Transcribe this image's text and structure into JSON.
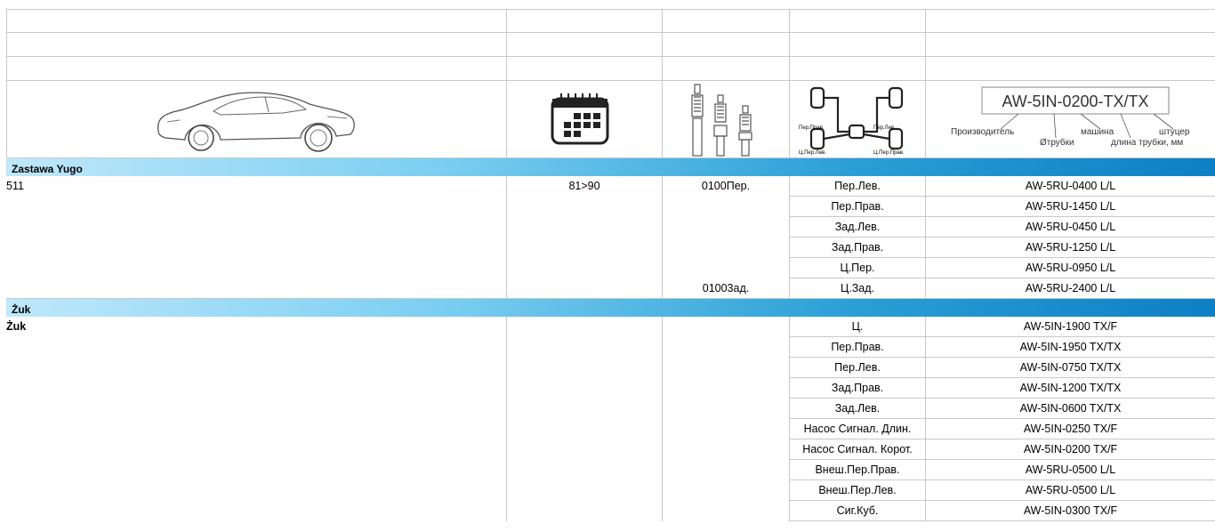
{
  "legend": {
    "code_sample": "AW-5IN-0200-TX/TX",
    "labels": {
      "manufacturer": "Производитель",
      "car": "машина",
      "fitting": "штуцер",
      "tube_diameter": "Øтрубки",
      "tube_length": "длина трубки, мм"
    },
    "axle_labels": {
      "front_right": "Пер.Прав.",
      "front_left": "Пер.Лев.",
      "center_rear_left": "Ц.Пер.Лев.",
      "center_rear_right": "Ц.Пер.Прав."
    }
  },
  "sections": [
    {
      "brand": "Zastawa Yugo",
      "model": "511",
      "years": "81>90",
      "codes": [
        "0100Пер.",
        "01003ад."
      ],
      "rows": [
        {
          "position": "Пер.Лев.",
          "part": "AW-5RU-0400 L/L"
        },
        {
          "position": "Пер.Прав.",
          "part": "AW-5RU-1450 L/L"
        },
        {
          "position": "Зад.Лев.",
          "part": "AW-5RU-0450 L/L"
        },
        {
          "position": "Зад.Прав.",
          "part": "AW-5RU-1250 L/L"
        },
        {
          "position": "Ц.Пер.",
          "part": "AW-5RU-0950 L/L"
        },
        {
          "position": "Ц.Зад.",
          "part": "AW-5RU-2400 L/L"
        }
      ]
    },
    {
      "brand": "Żuk",
      "model": "Żuk",
      "years": "",
      "codes": [],
      "rows": [
        {
          "position": "Ц.",
          "part": "AW-5IN-1900 TX/F"
        },
        {
          "position": "Пер.Прав.",
          "part": "AW-5IN-1950 TX/TX"
        },
        {
          "position": "Пер.Лев.",
          "part": "AW-5IN-0750 TX/TX"
        },
        {
          "position": "Зад.Прав.",
          "part": "AW-5IN-1200 TX/TX"
        },
        {
          "position": "Зад.Лев.",
          "part": "AW-5IN-0600 TX/TX"
        },
        {
          "position": "Насос Сигнал. Длин.",
          "part": "AW-5IN-0250 TX/F"
        },
        {
          "position": "Насос Сигнал. Корот.",
          "part": "AW-5IN-0200 TX/F"
        },
        {
          "position": "Внеш.Пер.Прав.",
          "part": "AW-5RU-0500 L/L"
        },
        {
          "position": "Внеш.Пер.Лев.",
          "part": "AW-5RU-0500 L/L"
        },
        {
          "position": "Сиг.Куб.",
          "part": "AW-5IN-0300 TX/F"
        }
      ]
    }
  ]
}
